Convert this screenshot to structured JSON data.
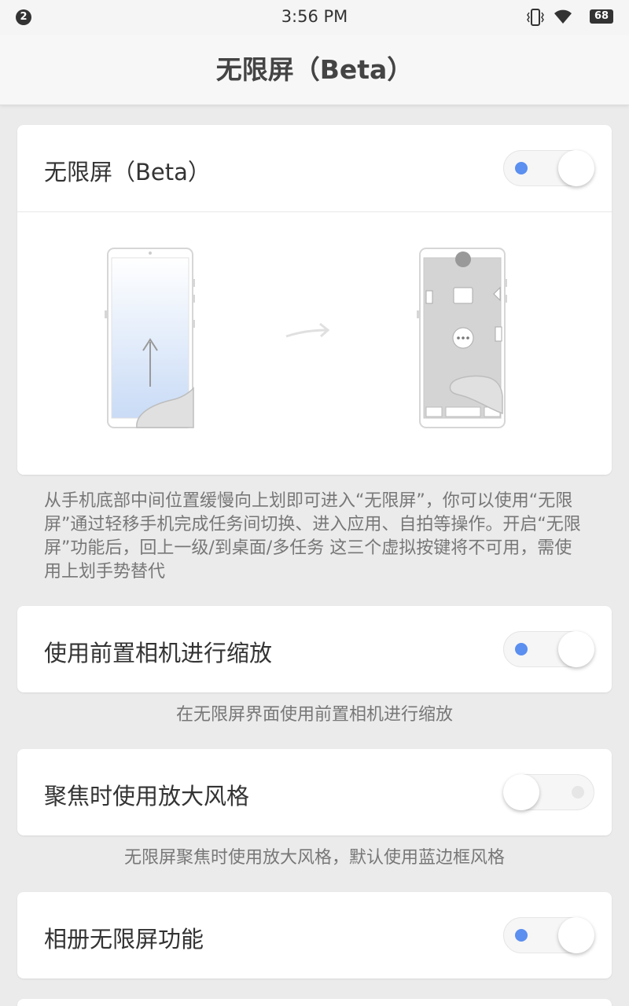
{
  "status_bar": {
    "notification_count": "2",
    "time": "3:56 PM",
    "battery": "68",
    "icons": [
      "vibrate-icon",
      "wifi-icon",
      "battery-icon"
    ]
  },
  "header": {
    "title": "无限屏（Beta）"
  },
  "settings": {
    "infinite_screen": {
      "label": "无限屏（Beta）",
      "enabled": true,
      "description": "从手机底部中间位置缓慢向上划即可进入“无限屏”，你可以使用“无限屏”通过轻移手机完成任务间切换、进入应用、自拍等操作。开启“无限屏”功能后，回上一级/到桌面/多任务 这三个虚拟按键将不可用，需使用上划手势替代"
    },
    "front_camera_zoom": {
      "label": "使用前置相机进行缩放",
      "enabled": true,
      "description": "在无限屏界面使用前置相机进行缩放"
    },
    "focus_zoom_style": {
      "label": "聚焦时使用放大风格",
      "enabled": false,
      "description": "无限屏聚焦时使用放大风格，默认使用蓝边框风格"
    },
    "gallery_infinite": {
      "label": "相册无限屏功能",
      "enabled": true
    }
  },
  "colors": {
    "accent": "#5b8ff0",
    "background": "#ebebeb"
  }
}
